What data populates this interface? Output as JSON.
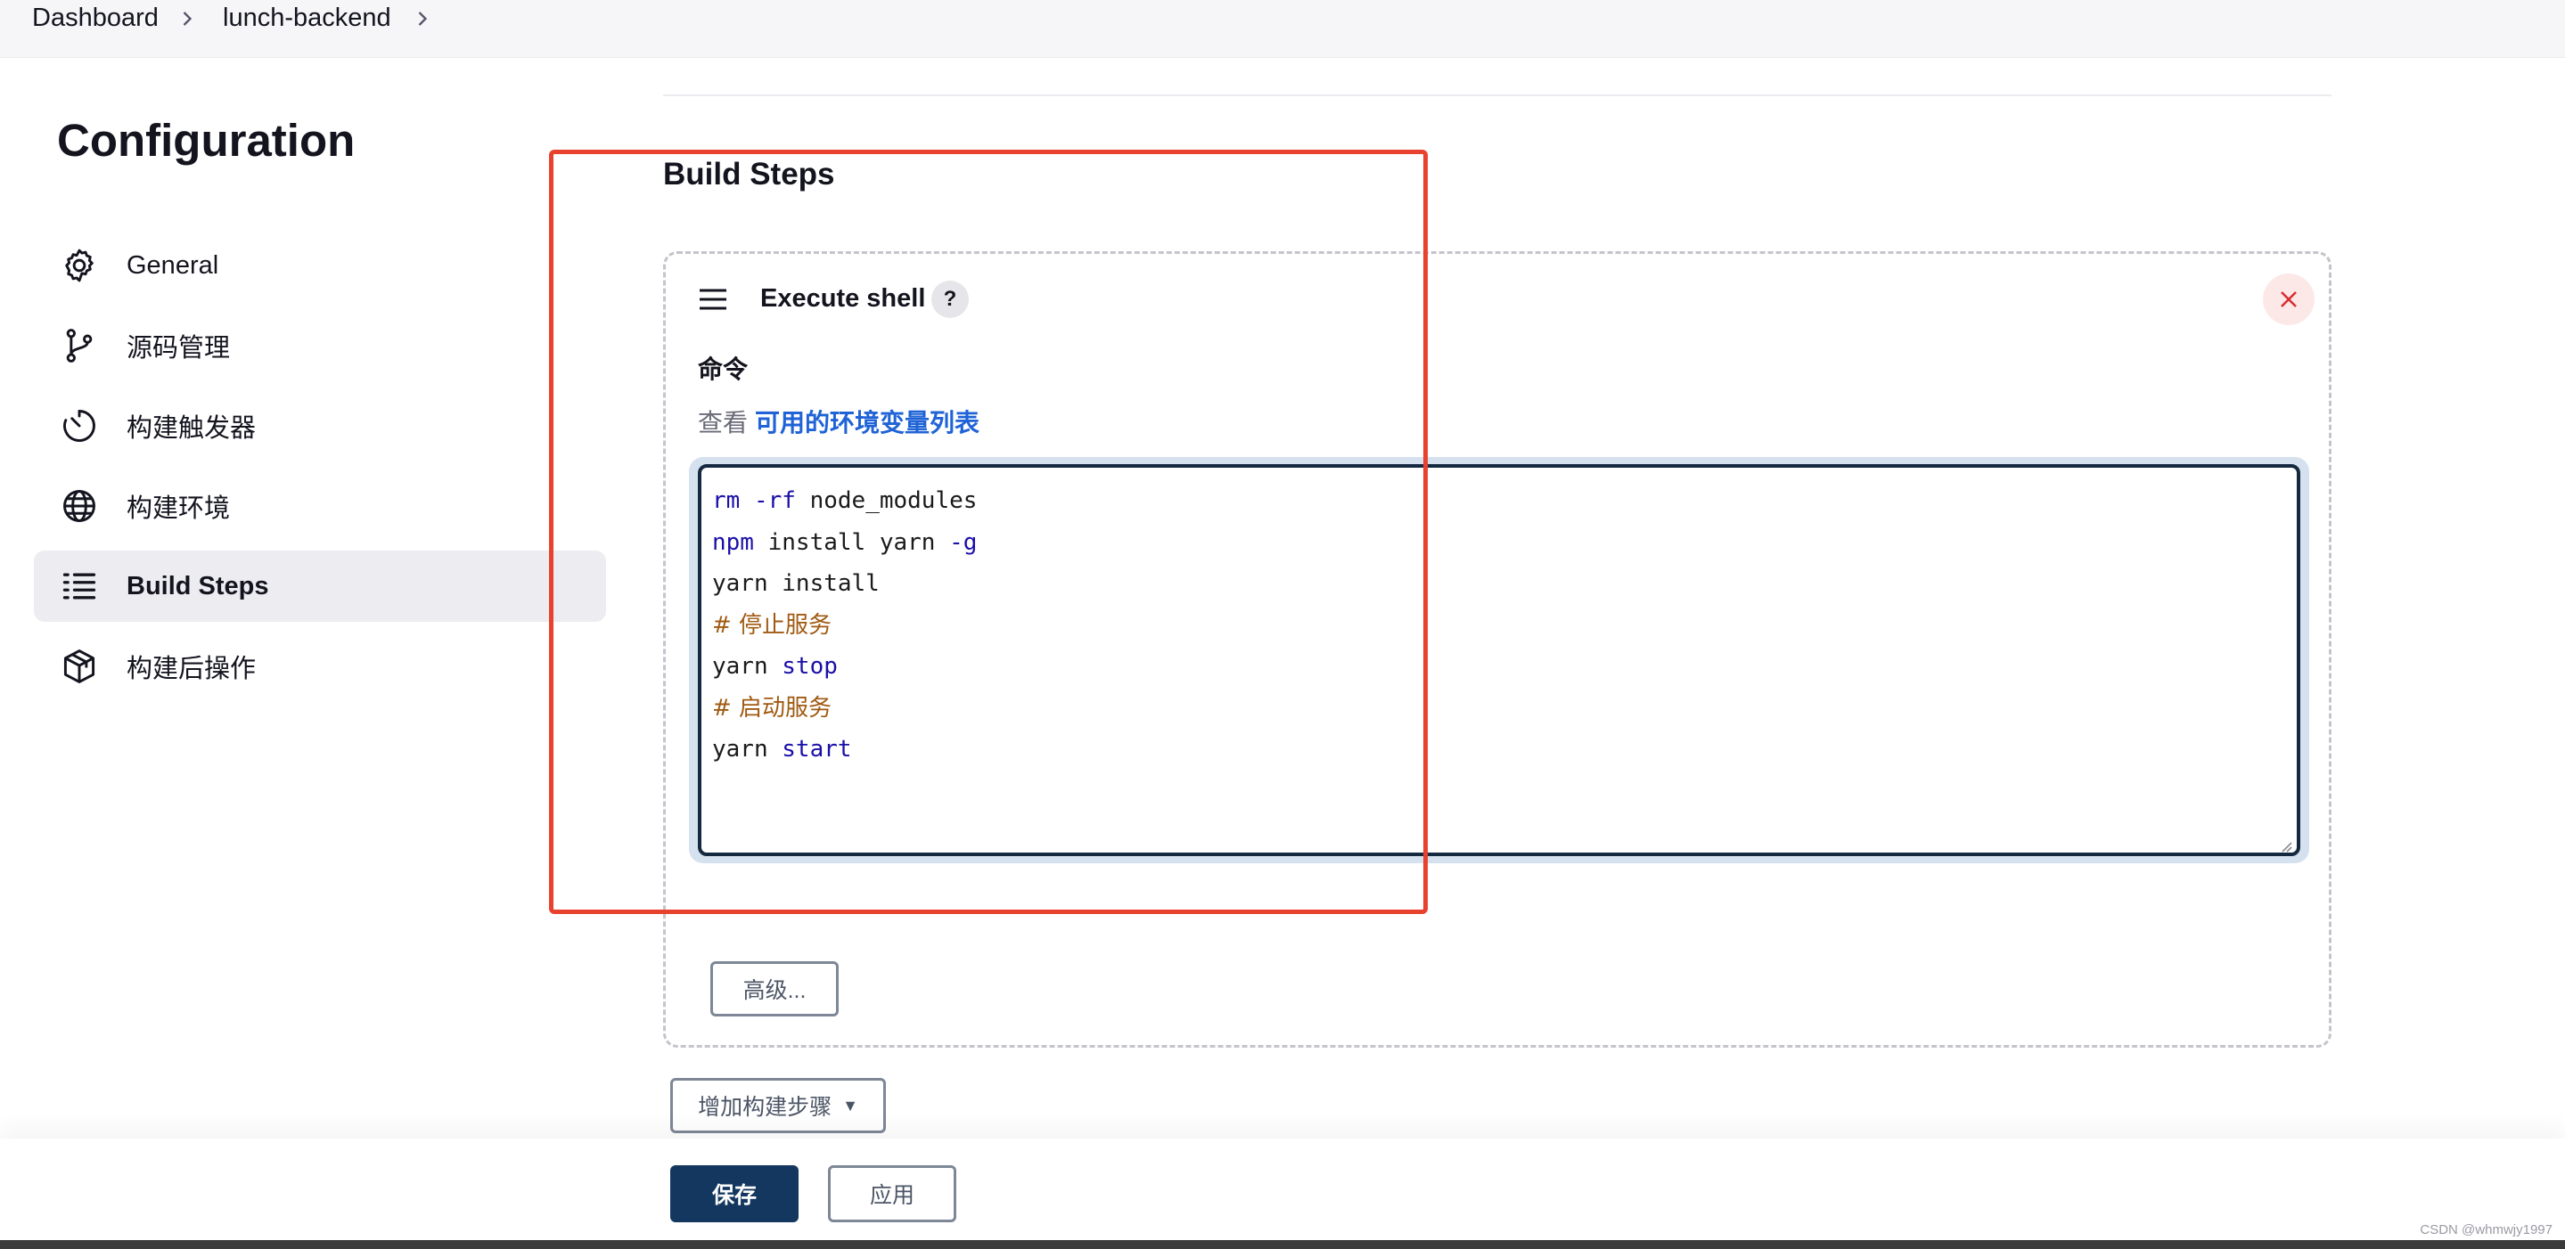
{
  "breadcrumb": {
    "items": [
      "Dashboard",
      "lunch-backend"
    ]
  },
  "sidebar": {
    "title": "Configuration",
    "items": [
      {
        "label": "General",
        "icon": "gear-icon"
      },
      {
        "label": "源码管理",
        "icon": "branch-icon"
      },
      {
        "label": "构建触发器",
        "icon": "timer-icon"
      },
      {
        "label": "构建环境",
        "icon": "globe-icon"
      },
      {
        "label": "Build Steps",
        "icon": "list-icon",
        "active": true
      },
      {
        "label": "构建后操作",
        "icon": "package-icon"
      }
    ]
  },
  "main": {
    "section_title": "Build Steps",
    "step": {
      "title": "Execute shell",
      "help": "?",
      "field_label": "命令",
      "hint_prefix": "查看",
      "hint_link": "可用的环境变量列表",
      "advanced_button": "高级...",
      "code": [
        [
          {
            "t": "rm -rf",
            "c": "kw"
          },
          {
            "t": " node_modules",
            "c": ""
          }
        ],
        [
          {
            "t": "npm",
            "c": "kw"
          },
          {
            "t": " install yarn ",
            "c": ""
          },
          {
            "t": "-g",
            "c": "kw"
          }
        ],
        [
          {
            "t": "yarn install",
            "c": ""
          }
        ],
        [
          {
            "t": "# 停止服务",
            "c": "cm"
          }
        ],
        [
          {
            "t": "yarn ",
            "c": ""
          },
          {
            "t": "stop",
            "c": "kw"
          }
        ],
        [
          {
            "t": "# 启动服务",
            "c": "cm"
          }
        ],
        [
          {
            "t": "yarn ",
            "c": ""
          },
          {
            "t": "start",
            "c": "kw"
          }
        ]
      ]
    },
    "add_step_button": "增加构建步骤"
  },
  "footer": {
    "save_button": "保存",
    "apply_button": "应用",
    "watermark": "CSDN @whmwjy1997"
  },
  "colors": {
    "highlight": "#e8412e",
    "primary": "#13375e",
    "link": "#1f63d6",
    "keyword": "#1a0fa8",
    "comment": "#a05a12"
  }
}
